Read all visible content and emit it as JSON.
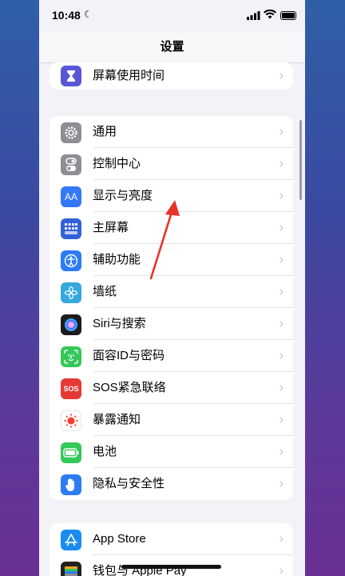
{
  "status_bar": {
    "time": "10:48",
    "moon": "☾"
  },
  "nav": {
    "title": "设置"
  },
  "top_group": {
    "items": [
      {
        "label": "屏幕使用时间",
        "icon": "hourglass-icon",
        "color": "#5856d6"
      }
    ]
  },
  "main_group": {
    "items": [
      {
        "label": "通用",
        "icon": "gear-icon",
        "color": "#8e8e93"
      },
      {
        "label": "控制中心",
        "icon": "toggle-icon",
        "color": "#8e8e93"
      },
      {
        "label": "显示与亮度",
        "icon": "aa-icon",
        "color": "#3478f6",
        "glyph": "AA"
      },
      {
        "label": "主屏幕",
        "icon": "home-grid-icon",
        "color": "#3461d9"
      },
      {
        "label": "辅助功能",
        "icon": "accessibility-icon",
        "color": "#2d7cf5"
      },
      {
        "label": "墙纸",
        "icon": "flower-icon",
        "color": "#34a9dc"
      },
      {
        "label": "Siri与搜索",
        "icon": "siri-icon",
        "color": "#222222"
      },
      {
        "label": "面容ID与密码",
        "icon": "face-id-icon",
        "color": "#34c759"
      },
      {
        "label": "SOS紧急联络",
        "icon": "sos-icon",
        "color": "#e53935",
        "glyph": "SOS"
      },
      {
        "label": "暴露通知",
        "icon": "exposure-icon",
        "color": "#ffffff"
      },
      {
        "label": "电池",
        "icon": "battery-icon",
        "color": "#34c759"
      },
      {
        "label": "隐私与安全性",
        "icon": "hand-icon",
        "color": "#2d7cf5"
      }
    ]
  },
  "store_group": {
    "items": [
      {
        "label": "App Store",
        "icon": "app-store-icon",
        "color": "#1a8cf0"
      },
      {
        "label": "钱包与 Apple Pay",
        "icon": "wallet-icon",
        "color": "#222222"
      }
    ]
  },
  "chevron": "›"
}
